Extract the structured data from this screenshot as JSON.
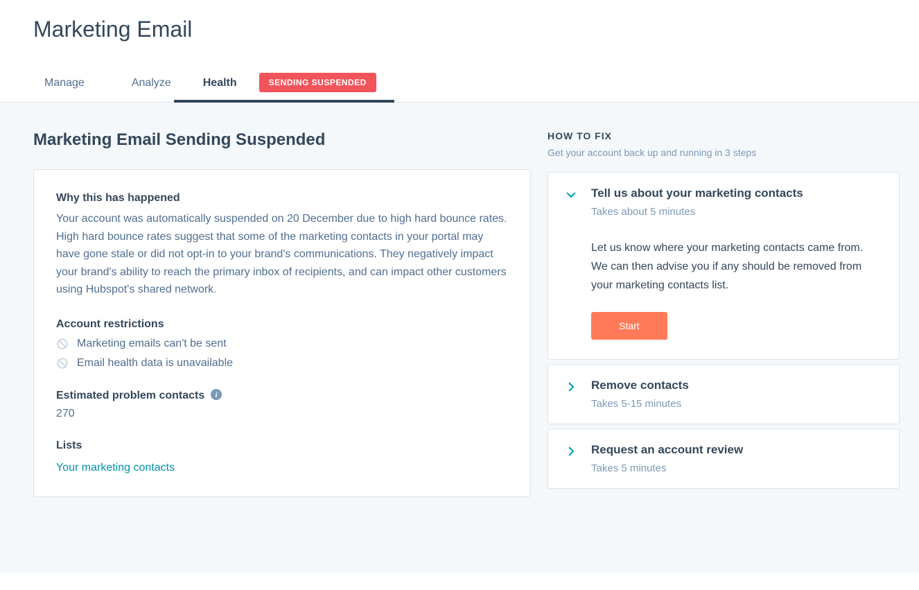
{
  "page": {
    "title": "Marketing Email"
  },
  "tabs": {
    "items": [
      "Manage",
      "Analyze",
      "Health"
    ],
    "activeIndex": 2,
    "badge": "SENDING SUSPENDED"
  },
  "main": {
    "heading": "Marketing Email Sending Suspended",
    "why": {
      "title": "Why this has happened",
      "body": "Your account was automatically suspended on 20 December due to high hard bounce rates. High hard bounce rates suggest that some of the marketing contacts in your portal may have gone stale or did not opt-in to your brand's communications. They negatively impact your brand's ability to reach the primary inbox of recipients, and can impact other customers using Hubspot's shared network."
    },
    "restrictions": {
      "title": "Account restrictions",
      "items": [
        "Marketing emails can't be sent",
        "Email health data is unavailable"
      ]
    },
    "problemContacts": {
      "title": "Estimated problem contacts",
      "value": "270"
    },
    "lists": {
      "title": "Lists",
      "link": "Your marketing contacts"
    }
  },
  "howto": {
    "title": "HOW TO FIX",
    "subtitle": "Get your account back up and running in 3 steps",
    "steps": [
      {
        "title": "Tell us about your marketing contacts",
        "time": "Takes about 5 minutes",
        "description": "Let us know where your marketing contacts came from. We can then advise you if any should be removed from your marketing contacts list.",
        "button": "Start",
        "expanded": true
      },
      {
        "title": "Remove contacts",
        "time": "Takes 5-15 minutes",
        "expanded": false
      },
      {
        "title": "Request an account review",
        "time": "Takes 5 minutes",
        "expanded": false
      }
    ]
  }
}
